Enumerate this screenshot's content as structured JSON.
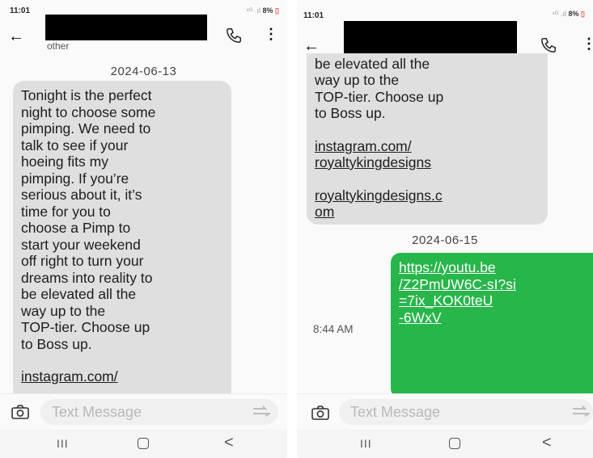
{
  "left_screen": {
    "status_time": "11:01",
    "status_signal": "⁴ᴳ",
    "status_battery": "8%",
    "contact_sub_label": "other",
    "date_separator": "2024-06-13",
    "message_lines": [
      "Tonight is the perfect",
      "night to choose some",
      "pimping. We need to",
      "talk to see if your",
      "hoeing fits my",
      "pimping. If you’re",
      "serious about it, it’s",
      "time for you to",
      "choose a Pimp to",
      "start your  weekend",
      "off right to turn your",
      "dreams into reality to",
      "be elevated all the",
      "way up to the",
      "TOP-tier. Choose up",
      "to Boss up."
    ],
    "link_1": "instagram.com/",
    "composer_placeholder": "Text Message"
  },
  "right_screen": {
    "status_time": "11:01",
    "status_signal": "⁴ᴳ",
    "status_battery": "8%",
    "message_lines": [
      "be elevated all the",
      "way up to the",
      "TOP-tier. Choose up",
      "to Boss up."
    ],
    "link_1_lines": [
      "instagram.com/",
      "royaltykingdesigns"
    ],
    "link_2_lines": [
      "royaltykingdesigns.c",
      "om"
    ],
    "date_separator": "2024-06-15",
    "outgoing_time": "8:44 AM",
    "outgoing_link_lines": [
      "https://youtu.be",
      "/Z2PmUW6C-sI?si",
      "=7ix_KOK0teU",
      "-6WxV"
    ],
    "composer_placeholder": "Text Message"
  },
  "nav": {
    "recents_glyph": "III",
    "back_glyph": "<"
  },
  "icons": [
    "back-arrow-icon",
    "phone-icon",
    "more-vertical-icon",
    "camera-icon",
    "send-icon",
    "recents-icon",
    "home-icon",
    "nav-back-icon"
  ],
  "colors": {
    "outgoing_bubble": "#27b64a",
    "incoming_bubble": "#dfdfdf",
    "redaction": "#000000"
  }
}
